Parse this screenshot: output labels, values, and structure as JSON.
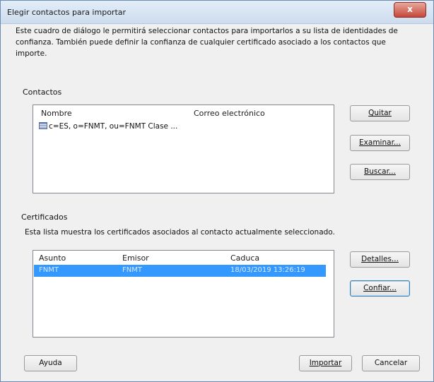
{
  "window": {
    "title": "Elegir contactos para importar",
    "close_label": "x"
  },
  "intro_text": "Este cuadro de diálogo le permitirá seleccionar contactos para importarlos a su lista de identidades de confianza. También puede definir la confianza de cualquier certificado asociado a los contactos que importe.",
  "contacts": {
    "group_label": "Contactos",
    "columns": [
      "Nombre",
      "Correo electrónico"
    ],
    "rows": [
      {
        "icon": "contact-card-icon",
        "name": "c=ES, o=FNMT, ou=FNMT Clase ...",
        "email": ""
      }
    ],
    "buttons": {
      "quitar": "Quitar",
      "examinar": "Examinar...",
      "buscar": "Buscar..."
    }
  },
  "certificates": {
    "group_label": "Certificados",
    "description": "Esta lista muestra los certificados asociados al contacto actualmente seleccionado.",
    "columns": [
      "Asunto",
      "Emisor",
      "Caduca"
    ],
    "rows": [
      {
        "subject": "FNMT",
        "issuer": "FNMT",
        "expires": "18/03/2019 13:26:19",
        "selected": true
      }
    ],
    "buttons": {
      "detalles": "Detalles...",
      "confiar": "Confiar..."
    }
  },
  "footer_buttons": {
    "ayuda": "Ayuda",
    "importar": "Importar",
    "cancelar": "Cancelar"
  },
  "colors": {
    "selection": "#3399ff",
    "title_gradient_top": "#e3edf8",
    "close_button": "#c6463a"
  }
}
